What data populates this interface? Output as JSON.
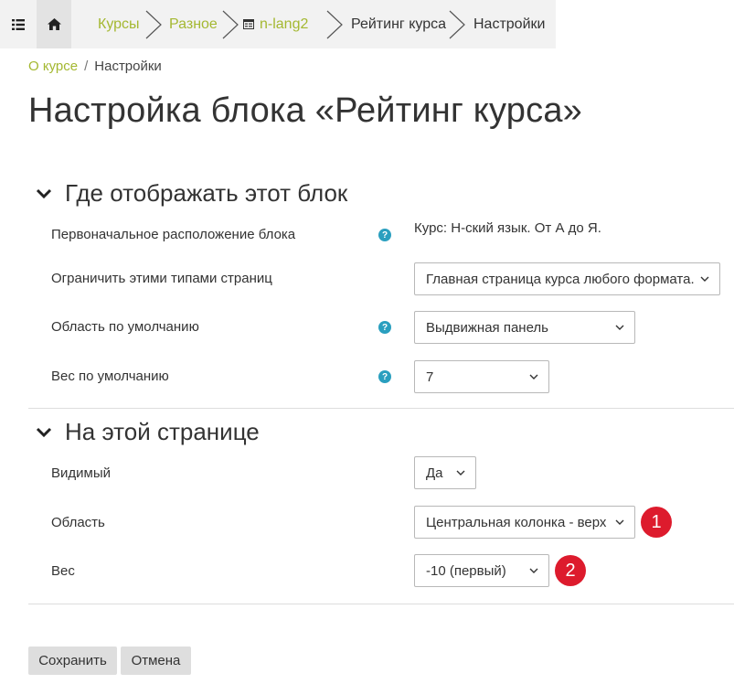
{
  "navbar": {
    "menu_icon": "list-icon",
    "home_icon": "home-icon",
    "breadcrumbs": [
      {
        "label": "Курсы",
        "link": true
      },
      {
        "label": "Разное",
        "link": true
      },
      {
        "label": "n-lang2",
        "link": true,
        "icon": "course-icon"
      },
      {
        "label": "Рейтинг курса",
        "link": false
      },
      {
        "label": "Настройки",
        "link": false
      }
    ]
  },
  "subcrumb": {
    "link": "О курсе",
    "separator": "/",
    "current": "Настройки"
  },
  "page_title": "Настройка блока «Рейтинг курса»",
  "sections": [
    {
      "title": "Где отображать этот блок",
      "rows": [
        {
          "label": "Первоначальное расположение блока",
          "help": true,
          "value": "Курс: Н-ский язык. От А до Я."
        },
        {
          "label": "Ограничить этими типами страниц",
          "help": false,
          "value": "Главная страница курса любого формата."
        },
        {
          "label": "Область по умолчанию",
          "help": true,
          "value": "Выдвижная панель"
        },
        {
          "label": "Вес по умолчанию",
          "help": true,
          "value": "7"
        }
      ]
    },
    {
      "title": "На этой странице",
      "rows": [
        {
          "label": "Видимый",
          "value": "Да"
        },
        {
          "label": "Область",
          "value": "Центральная колонка - верх"
        },
        {
          "label": "Вес",
          "value": "-10 (первый)"
        }
      ]
    }
  ],
  "annotations": [
    "1",
    "2"
  ],
  "buttons": {
    "save": "Сохранить",
    "cancel": "Отмена"
  },
  "colors": {
    "link": "#a4b831",
    "help_icon": "#2a9fbf",
    "badge": "#dd1b2d",
    "navbar_bg": "#f2f2f2"
  }
}
